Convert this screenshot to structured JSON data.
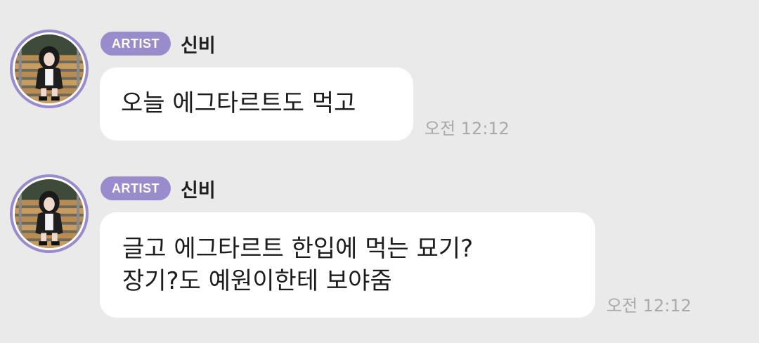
{
  "messages": [
    {
      "badge": "ARTIST",
      "author": "신비",
      "text": "오늘 에그타르트도 먹고",
      "time": "오전 12:12"
    },
    {
      "badge": "ARTIST",
      "author": "신비",
      "text": "글고 에그타르트 한입에 먹는 묘기?\n장기?도 예원이한테 보야줌",
      "time": "오전 12:12"
    }
  ],
  "colors": {
    "background": "#eaeaea",
    "badge": "#9a8ccc",
    "bubble": "#ffffff",
    "timestamp": "#a9a9a9"
  }
}
